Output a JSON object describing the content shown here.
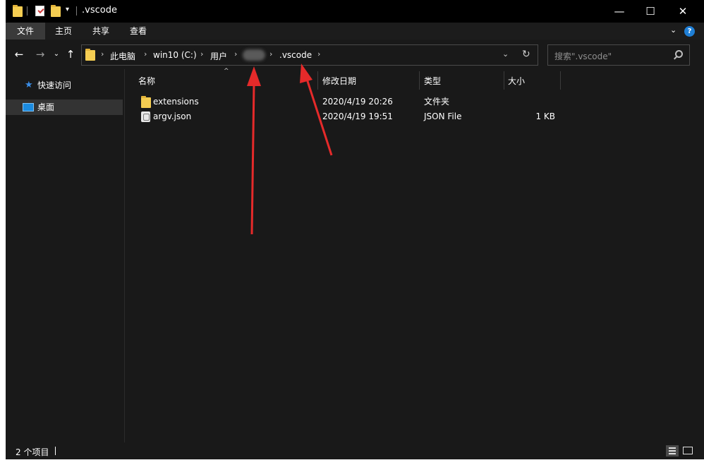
{
  "window": {
    "title": ".vscode",
    "controls": {
      "minimize": "—",
      "maximize": "☐",
      "close": "✕"
    }
  },
  "ribbon": {
    "tabs": [
      {
        "label": "文件",
        "active": true
      },
      {
        "label": "主页",
        "active": false
      },
      {
        "label": "共享",
        "active": false
      },
      {
        "label": "查看",
        "active": false
      }
    ],
    "help": "?"
  },
  "address": {
    "crumbs": [
      "此电脑",
      "win10 (C:)",
      "用户",
      ".vscode"
    ],
    "search_placeholder": "搜索\".vscode\""
  },
  "nav_pane": {
    "items": [
      {
        "label": "快速访问",
        "icon": "star-icon",
        "selected": false
      },
      {
        "label": "桌面",
        "icon": "desktop-icon",
        "selected": true
      }
    ]
  },
  "file_list": {
    "columns": [
      "名称",
      "修改日期",
      "类型",
      "大小"
    ],
    "rows": [
      {
        "name": "extensions",
        "modified": "2020/4/19 20:26",
        "type": "文件夹",
        "size": "",
        "icon": "folder-icon"
      },
      {
        "name": "argv.json",
        "modified": "2020/4/19 19:51",
        "type": "JSON File",
        "size": "1 KB",
        "icon": "json-file-icon"
      }
    ]
  },
  "status": {
    "item_count": "2 个项目"
  },
  "colors": {
    "background": "#191919",
    "titlebar": "#000000",
    "accent": "#1f7fd6",
    "folder": "#f5cd52",
    "arrow": "#e52a2a"
  }
}
